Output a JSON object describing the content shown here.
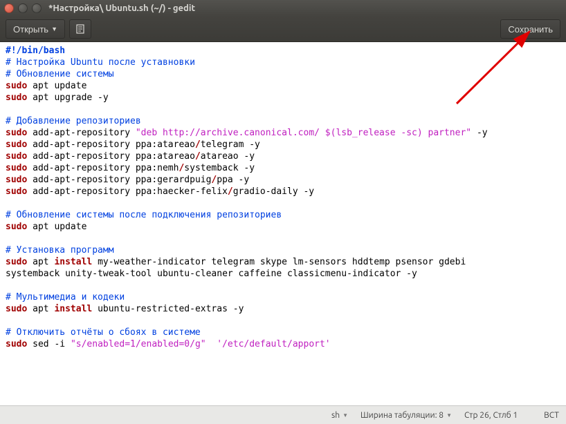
{
  "window": {
    "title": "*Настройка\\ Ubuntu.sh (~/) - gedit"
  },
  "toolbar": {
    "open_label": "Открыть",
    "save_label": "Сохранить"
  },
  "code": {
    "shebang": "#!/bin/bash",
    "c1": "# Настройка Ubuntu после уставновки",
    "c2": "# Обновление системы",
    "sudo": "sudo",
    "l3": " apt update",
    "l4": " apt upgrade -y",
    "c5": "# Добавление репозиториев",
    "l6a": " add-apt-repository ",
    "l6b": "\"deb http://archive.canonical.com/ $(lsb_release -sc) partner\"",
    "l6c": " -y",
    "l7a": " add-apt-repository ppa:atareao",
    "slash": "/",
    "l7b": "telegram -y",
    "l8b": "atareao -y",
    "l9a": " add-apt-repository ppa:nemh",
    "l9b": "systemback -y",
    "l10a": " add-apt-repository ppa:gerardpuig",
    "l10b": "ppa -y",
    "l11a": " add-apt-repository ppa:haecker-felix",
    "l11b": "gradio-daily -y",
    "c12": "# Обновление системы после подключения репозиториев",
    "c13": "# Установка программ",
    "l14a": " apt ",
    "install": "install",
    "l14b": " my-weather-indicator telegram skype lm-sensors hddtemp psensor gdebi ",
    "l14b2": "systemback unity-tweak-tool ubuntu-cleaner caffeine classicmenu-indicator -y",
    "c15": "# Мультимедиа и кодеки",
    "l16b": " ubuntu-restricted-extras -y",
    "c17": "# Отключить отчёты о сбоях в системе",
    "l18a": " sed ",
    "l18b": "-i ",
    "l18c": "\"s/enabled=1/enabled=0/g\"",
    "sp": "  ",
    "l18d": "'/etc/default/apport'"
  },
  "status": {
    "lang": "sh",
    "tab_label": "Ширина табуляции: 8",
    "pos_label": "Стр 26, Стлб 1",
    "ins_label": "ВСТ"
  }
}
